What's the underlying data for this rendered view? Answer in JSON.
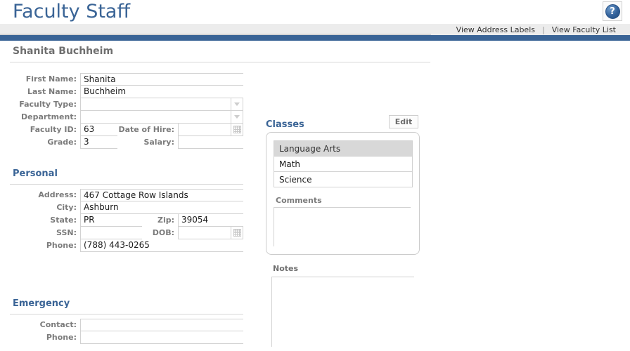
{
  "app": {
    "title": "Faculty Staff",
    "help_icon_label": "?",
    "accent_color": "#3a6496",
    "bar_color": "#3a6496",
    "strip_color": "#ececec"
  },
  "nav": {
    "links": [
      {
        "label": "View Address Labels"
      },
      {
        "label": "View Faculty List"
      }
    ],
    "separator": "|"
  },
  "record": {
    "title": "Shanita Buchheim"
  },
  "form": {
    "fields": {
      "first_name": {
        "label": "First Name:",
        "value": "Shanita"
      },
      "last_name": {
        "label": "Last Name:",
        "value": "Buchheim"
      },
      "faculty_type": {
        "label": "Faculty Type:",
        "value": ""
      },
      "department": {
        "label": "Department:",
        "value": ""
      },
      "faculty_id": {
        "label": "Faculty ID:",
        "value": "63"
      },
      "date_of_hire": {
        "label": "Date of Hire:",
        "value": ""
      },
      "grade": {
        "label": "Grade:",
        "value": "3"
      },
      "salary": {
        "label": "Salary:",
        "value": ""
      }
    }
  },
  "personal": {
    "heading": "Personal",
    "fields": {
      "address": {
        "label": "Address:",
        "value": "467 Cottage Row Islands"
      },
      "city": {
        "label": "City:",
        "value": "Ashburn"
      },
      "state": {
        "label": "State:",
        "value": "PR"
      },
      "zip": {
        "label": "Zip:",
        "value": "39054"
      },
      "ssn": {
        "label": "SSN:",
        "value": ""
      },
      "dob": {
        "label": "DOB:",
        "value": ""
      },
      "phone": {
        "label": "Phone:",
        "value": "(788) 443-0265"
      }
    }
  },
  "emergency": {
    "heading": "Emergency",
    "fields": {
      "contact": {
        "label": "Contact:",
        "value": ""
      },
      "phone": {
        "label": "Phone:",
        "value": ""
      }
    }
  },
  "classes": {
    "heading": "Classes",
    "edit_label": "Edit",
    "items": [
      {
        "label": "Language Arts",
        "selected": true
      },
      {
        "label": "Math",
        "selected": false
      },
      {
        "label": "Science",
        "selected": false
      }
    ],
    "comments": {
      "label": "Comments",
      "value": ""
    }
  },
  "notes": {
    "label": "Notes",
    "value": ""
  }
}
